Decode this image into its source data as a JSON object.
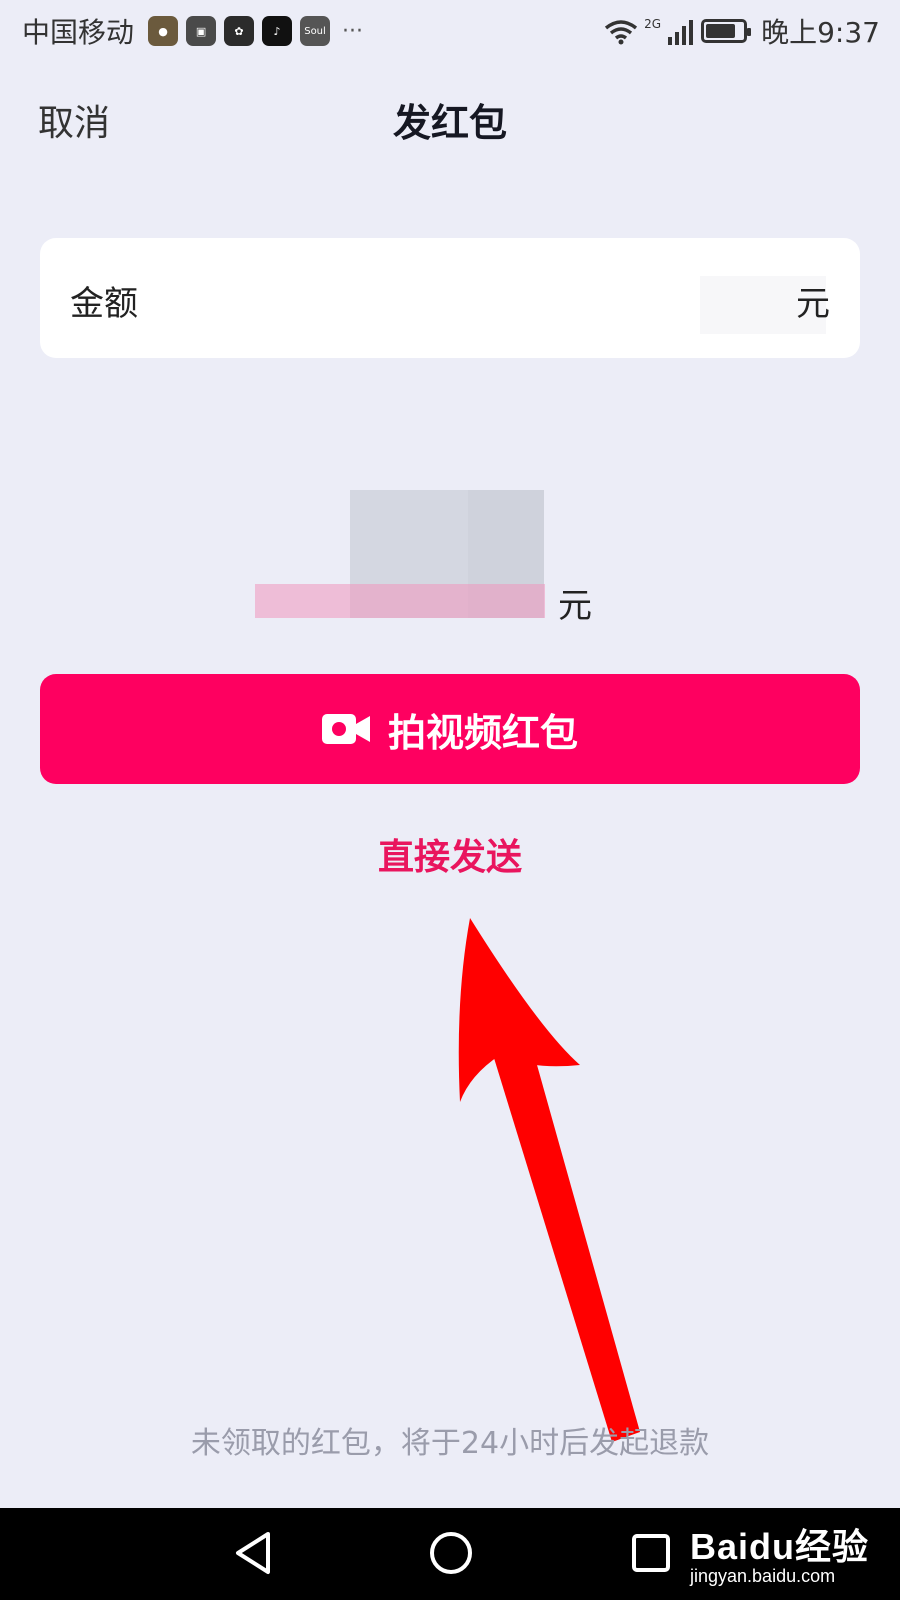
{
  "status_bar": {
    "carrier": "中国移动",
    "app_icons": [
      "app-icon-1",
      "app-icon-2",
      "huawei-icon",
      "tiktok-icon",
      "soul-icon"
    ],
    "soul_label": "Soul",
    "more": "···",
    "network": "2G",
    "time": "晚上9:37",
    "battery_level": 0.8
  },
  "header": {
    "cancel_label": "取消",
    "title": "发红包"
  },
  "amount": {
    "label": "金额",
    "value": "",
    "unit": "元"
  },
  "total": {
    "unit": "元"
  },
  "actions": {
    "video_button_label": "拍视频红包",
    "direct_send_label": "直接发送"
  },
  "footer": {
    "refund_note": "未领取的红包，将于24小时后发起退款"
  },
  "watermark": {
    "logo": "Baidu经验",
    "url": "jingyan.baidu.com"
  },
  "colors": {
    "background": "#ECEDF7",
    "primary": "#FE0060",
    "link": "#E9155E",
    "annotation_arrow": "#FF0000"
  }
}
